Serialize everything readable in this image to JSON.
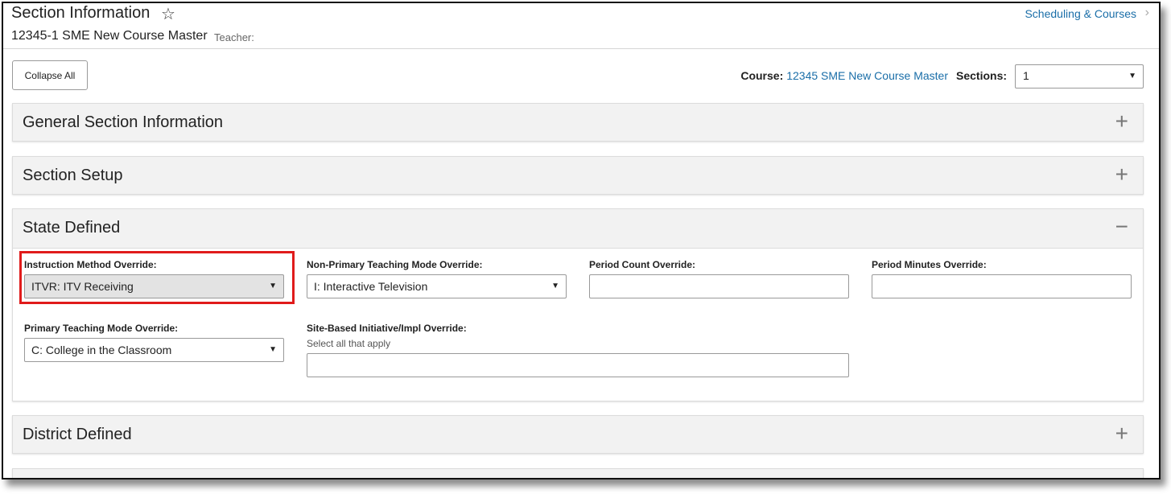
{
  "header": {
    "title": "Section Information",
    "subtitle": "12345-1 SME New Course Master",
    "teacher_label": "Teacher:",
    "breadcrumb": "Scheduling & Courses"
  },
  "toolbar": {
    "collapse_all": "Collapse All",
    "course_label": "Course:",
    "course_value": "12345 SME New Course Master",
    "sections_label": "Sections:",
    "sections_value": "1"
  },
  "panels": [
    {
      "title": "General Section Information",
      "toggle": "+"
    },
    {
      "title": "Section Setup",
      "toggle": "+"
    },
    {
      "title": "State Defined",
      "toggle": "−"
    },
    {
      "title": "District Defined",
      "toggle": "+"
    }
  ],
  "state_defined": {
    "instruction_method": {
      "label": "Instruction Method Override:",
      "value": "ITVR: ITV Receiving"
    },
    "non_primary_mode": {
      "label": "Non-Primary Teaching Mode Override:",
      "value": "I: Interactive Television"
    },
    "period_count": {
      "label": "Period Count Override:",
      "value": ""
    },
    "period_minutes": {
      "label": "Period Minutes Override:",
      "value": ""
    },
    "primary_mode": {
      "label": "Primary Teaching Mode Override:",
      "value": "C: College in the Classroom"
    },
    "site_based": {
      "label": "Site-Based Initiative/Impl Override:",
      "hint": "Select all that apply",
      "value": ""
    }
  },
  "colors": {
    "link": "#1a6ea8",
    "highlight": "#e01b1b",
    "panel_bg": "#f2f2f2"
  },
  "icons": {
    "favorite": "star-outline-icon",
    "expand": "plus-icon",
    "collapse": "minus-icon",
    "dropdown": "caret-down-icon"
  }
}
